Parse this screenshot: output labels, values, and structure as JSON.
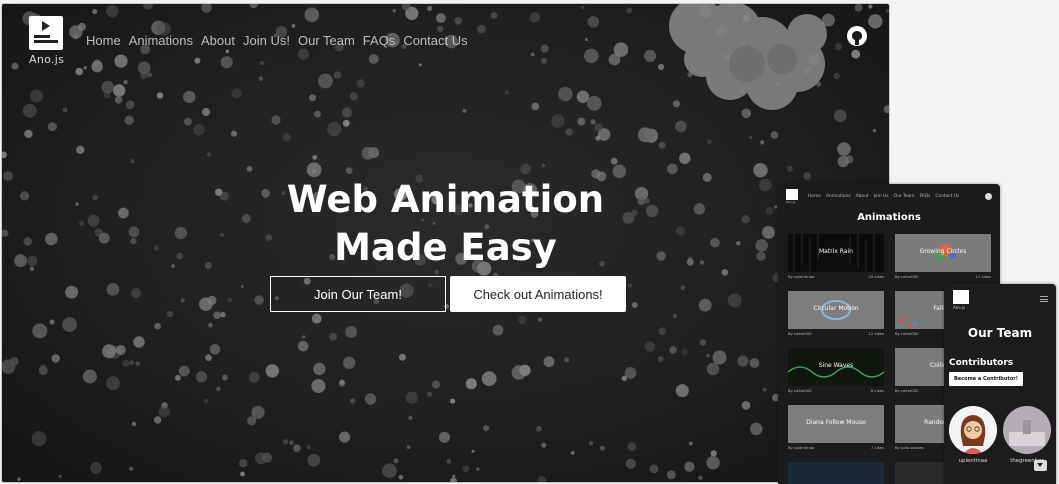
{
  "desktop": {
    "logo_text": "Ano.js",
    "nav": [
      "Home",
      "Animations",
      "About",
      "Join Us!",
      "Our Team",
      "FAQs",
      "Contact Us"
    ],
    "hero_line1": "Web Animation",
    "hero_line2": "Made Easy",
    "btn_join": "Join Our Team!",
    "btn_animations": "Check out Animations!",
    "github_icon": "github-icon"
  },
  "tablet": {
    "logo_text": "Ano.js",
    "nav": [
      "Home",
      "Animations",
      "About",
      "Join Us",
      "Our Team",
      "FAQs",
      "Contact Us"
    ],
    "title": "Animations",
    "cards": [
      {
        "title": "Matrix Rain",
        "author": "By uplentinaa",
        "likes": "20 Likes"
      },
      {
        "title": "Growing Circles",
        "author": "By calixt000",
        "likes": "11 Likes"
      },
      {
        "title": "Circular Motion",
        "author": "By calixt000",
        "likes": "12 Likes"
      },
      {
        "title": "Falling",
        "author": "By calixt000",
        "likes": ""
      },
      {
        "title": "Sine Waves",
        "author": "By calixt000",
        "likes": "8 Likes"
      },
      {
        "title": "Colliding",
        "author": "By calixt000",
        "likes": ""
      },
      {
        "title": "Diana Follow Mouse",
        "author": "By uplentinaa",
        "likes": "7 Likes"
      },
      {
        "title": "Random Pop",
        "author": "By jullo-sanaes",
        "likes": ""
      }
    ]
  },
  "phone": {
    "logo_text": "Ano.js",
    "title": "Our Team",
    "subtitle": "Contributors",
    "button": "Become a Contributor!",
    "contributors": [
      "uplentinaa",
      "thegreenbgr"
    ]
  }
}
